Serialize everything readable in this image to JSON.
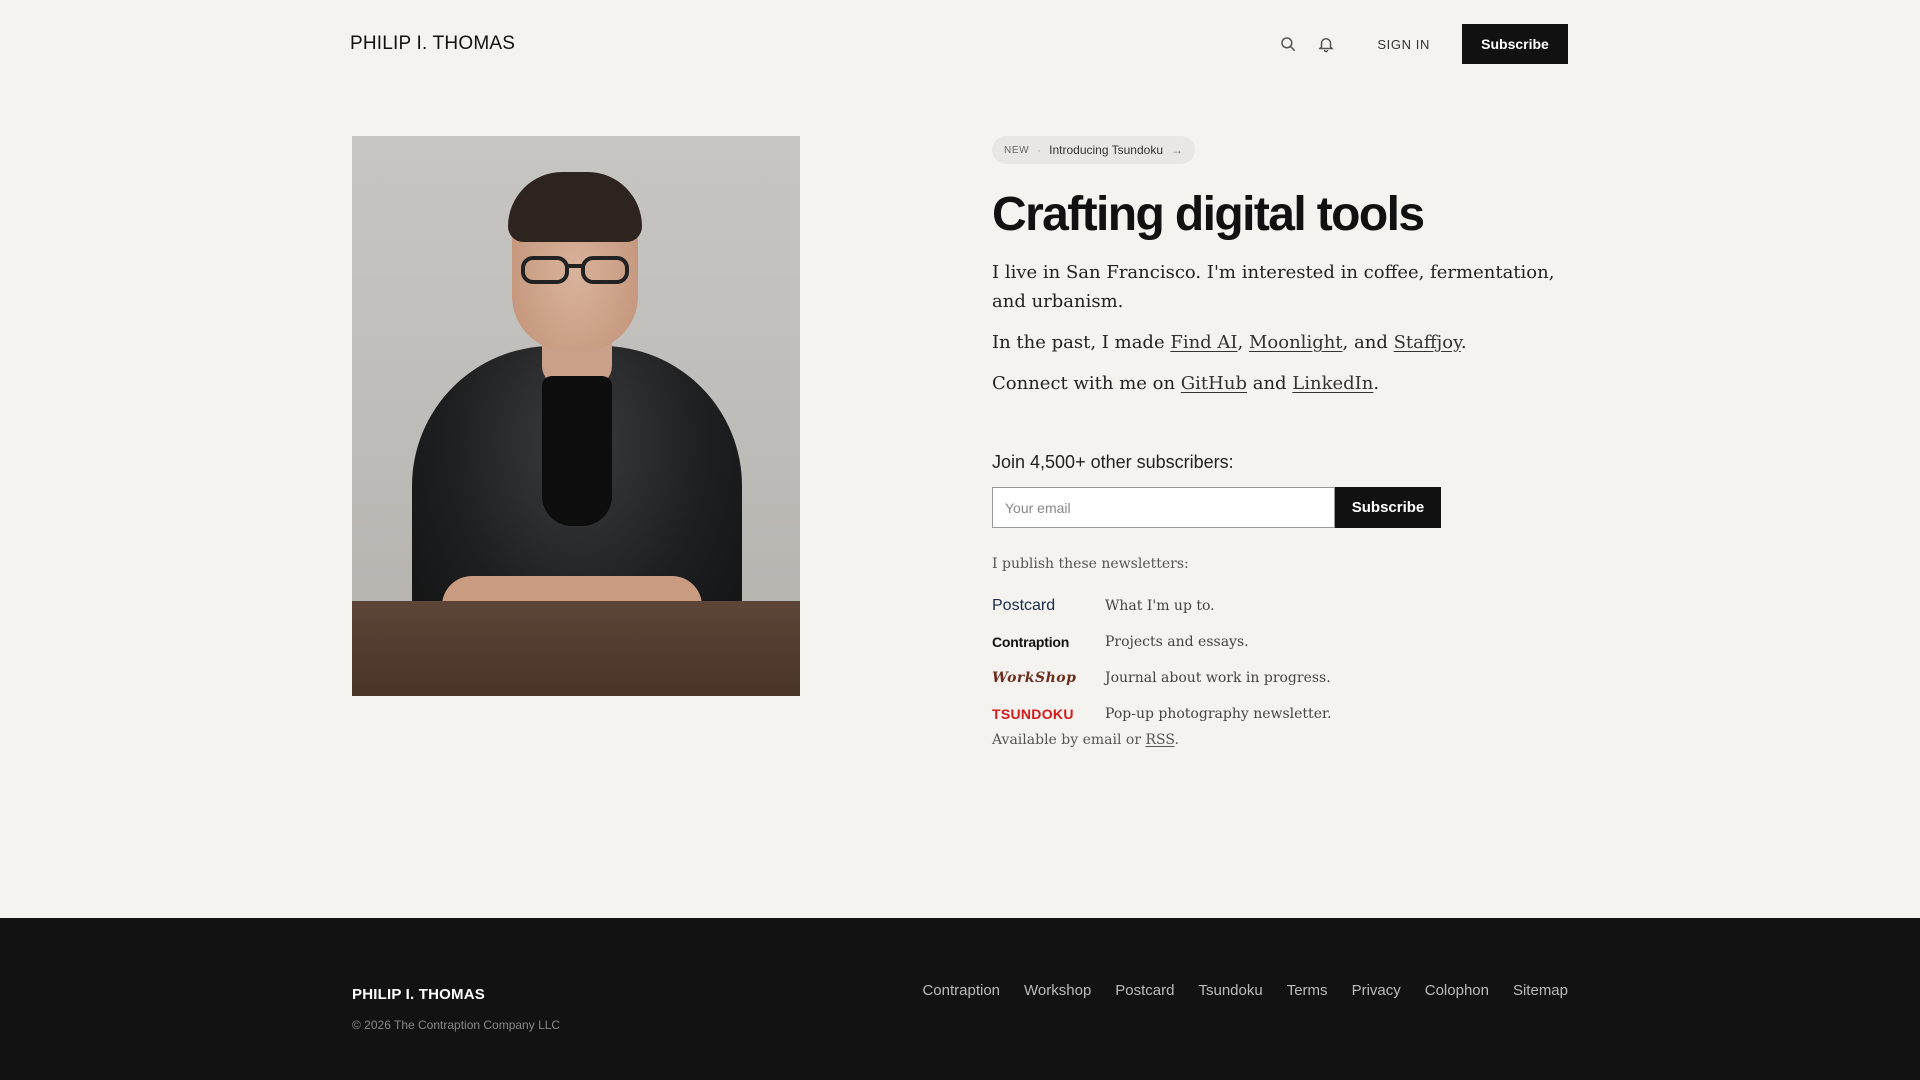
{
  "header": {
    "site_title": "PHILIP I. THOMAS",
    "signin_label": "SIGN IN",
    "subscribe_label": "Subscribe"
  },
  "hero": {
    "pill_tag": "NEW",
    "pill_separator": "·",
    "pill_text": "Introducing Tsundoku",
    "pill_arrow": "→",
    "headline": "Crafting digital tools",
    "para1": "I live in San Francisco. I'm interested in coffee, fermentation, and urbanism.",
    "para2_prefix": "In the past, I made ",
    "para2_link1": "Find AI",
    "para2_sep1": ", ",
    "para2_link2": "Moonlight",
    "para2_sep2": ", and ",
    "para2_link3": "Staffjoy",
    "para2_suffix": ".",
    "para3_prefix": "Connect with me on ",
    "para3_link1": "GitHub",
    "para3_sep": " and ",
    "para3_link2": "LinkedIn",
    "para3_suffix": "."
  },
  "signup": {
    "heading": "Join 4,500+ other subscribers:",
    "email_placeholder": "Your email",
    "button_label": "Subscribe"
  },
  "newsletters": {
    "intro": "I publish these newsletters:",
    "items": [
      {
        "name": "Postcard",
        "desc": "What I'm up to."
      },
      {
        "name": "Contraption",
        "desc": "Projects and essays."
      },
      {
        "name": "WorkShop",
        "desc": "Journal about work in progress."
      },
      {
        "name": "TSUNDOKU",
        "desc": "Pop-up photography newsletter."
      }
    ],
    "available_prefix": "Available by email or ",
    "available_link": "RSS",
    "available_suffix": "."
  },
  "footer": {
    "title": "PHILIP I. THOMAS",
    "copyright": "© 2026 The Contraption Company LLC",
    "nav": [
      "Contraption",
      "Workshop",
      "Postcard",
      "Tsundoku",
      "Terms",
      "Privacy",
      "Colophon",
      "Sitemap"
    ]
  },
  "colors": {
    "background": "#f4f3ef",
    "primary": "#111111",
    "footer_bg": "#121212",
    "tsundoku_red": "#d41a1a",
    "postcard_navy": "#1b2a4a",
    "workshop_brown": "#6b2e1e"
  },
  "icons": {
    "search": "search-icon",
    "notifications": "bell-icon",
    "arrow": "arrow-right-icon"
  }
}
